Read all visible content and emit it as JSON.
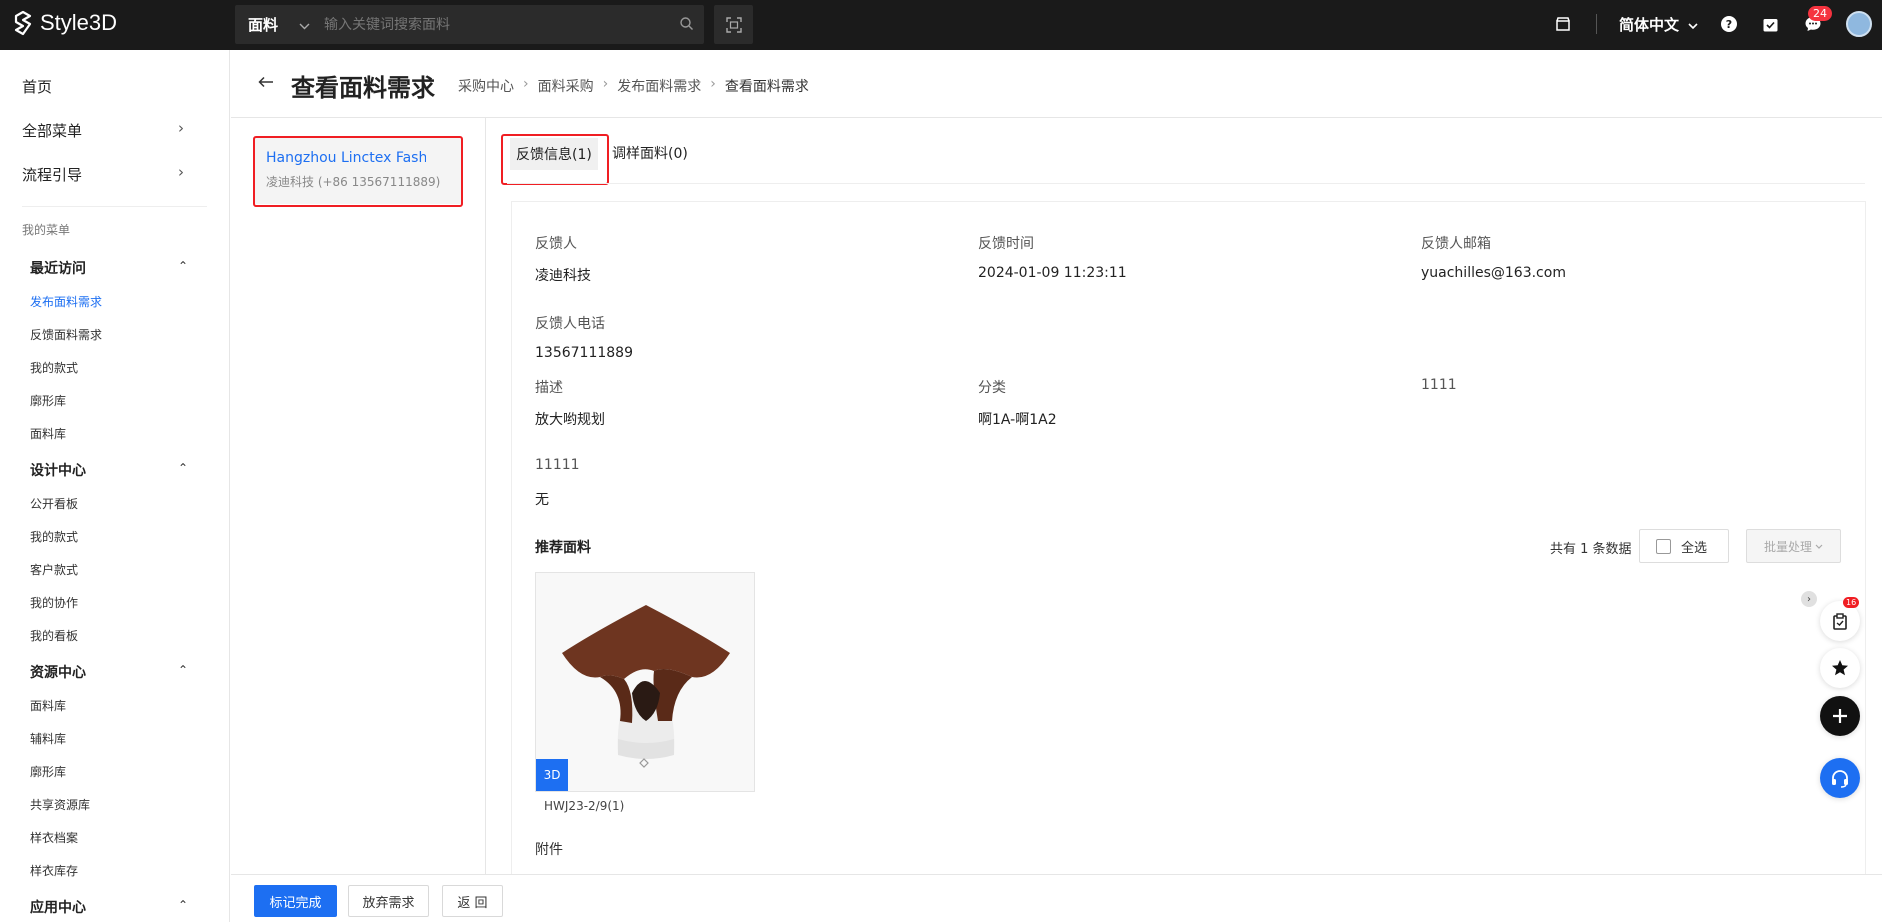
{
  "app": {
    "logo_text": "Style3D"
  },
  "search": {
    "category": "面料",
    "placeholder": "输入关键词搜索面料"
  },
  "header": {
    "language": "简体中文",
    "message_badge": "24"
  },
  "sidebar": {
    "top_items": [
      {
        "label": "首页"
      },
      {
        "label": "全部菜单"
      },
      {
        "label": "流程引导"
      }
    ],
    "my_menu_label": "我的菜单",
    "groups": [
      {
        "title": "最近访问",
        "items": [
          "发布面料需求",
          "反馈面料需求",
          "我的款式",
          "廓形库",
          "面料库"
        ]
      },
      {
        "title": "设计中心",
        "items": [
          "公开看板",
          "我的款式",
          "客户款式",
          "我的协作",
          "我的看板"
        ]
      },
      {
        "title": "资源中心",
        "items": [
          "面料库",
          "辅料库",
          "廓形库",
          "共享资源库",
          "样衣档案",
          "样衣库存"
        ]
      },
      {
        "title": "应用中心",
        "items": []
      }
    ]
  },
  "page": {
    "title": "查看面料需求",
    "breadcrumb": [
      "采购中心",
      "面料采购",
      "发布面料需求",
      "查看面料需求"
    ]
  },
  "supplier": {
    "name": "Hangzhou Linctex Fashion",
    "sub": "凌迪科技 (+86 13567111889)"
  },
  "tabs": [
    {
      "label": "反馈信息(1)"
    },
    {
      "label": "调样面料(0)"
    }
  ],
  "feedback": {
    "person_label": "反馈人",
    "person_value": "凌迪科技",
    "time_label": "反馈时间",
    "time_value": "2024-01-09 11:23:11",
    "email_label": "反馈人邮箱",
    "email_value": "yuachilles@163.com",
    "phone_label": "反馈人电话",
    "phone_value": "13567111889",
    "desc_label": "描述",
    "desc_value": "放大哟规划",
    "category_label": "分类",
    "category_value": "啊1A-啊1A2",
    "field1111_label": "1111",
    "field1111_value": "",
    "field11111_label": "11111",
    "field11111_value": "无"
  },
  "recommend": {
    "title": "推荐面料",
    "total_text": "共有 1 条数据",
    "select_all": "全选",
    "batch": "批量处理",
    "items": [
      {
        "badge": "3D",
        "code": "HWJ23-2/9(1)"
      }
    ],
    "attachment_label": "附件"
  },
  "float_tools": {
    "cart_badge": "16"
  },
  "footer": {
    "complete": "标记完成",
    "abandon": "放弃需求",
    "back": "返 回"
  },
  "colors": {
    "accent": "#1d6ff2",
    "highlight_red": "#f01e23",
    "topbar": "#1a1a1a"
  }
}
